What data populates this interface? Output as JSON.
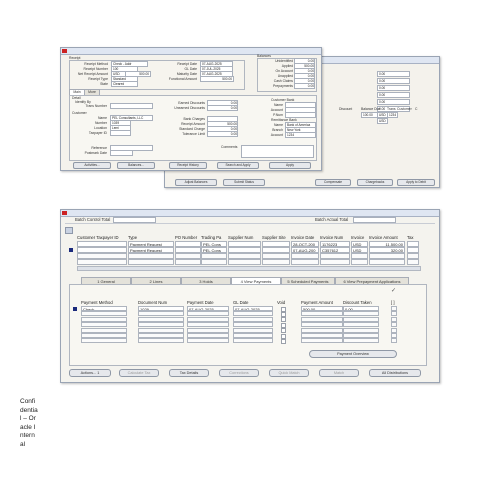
{
  "colors": {
    "selected_row": "#1b2a7c",
    "close_box": "#cc2222",
    "titlebar": "#dfe6f2"
  },
  "icons": {
    "close": "close-icon",
    "calendar": "calendar-icon",
    "flashlight": "flashlight-icon",
    "checkmark": "checkmark-icon",
    "scroll_up": "chevron-up-icon",
    "scroll_down": "chevron-down-icon"
  },
  "receipts_window": {
    "receipt_section": "Receipt",
    "fields": {
      "receipt_method_label": "Receipt Method",
      "receipt_method_value": "Check - Addr",
      "receipt_number_label": "Receipt Number",
      "receipt_number_value": "100",
      "net_receipt_amount_label": "Net Receipt Amount",
      "net_receipt_amount_currency": "USD",
      "net_receipt_amount_value": "500.00",
      "receipt_type_label": "Receipt Type",
      "receipt_type_value": "Standard",
      "state_label": "State",
      "state_value": "Cleared",
      "receipt_date_label": "Receipt Date",
      "receipt_date_value": "07-AUG-2025",
      "gl_date_label": "GL Date",
      "gl_date_value": "07-JUL-2025",
      "maturity_date_label": "Maturity Date",
      "maturity_date_value": "07-AUG-2025",
      "functional_amount_label": "Functional Amount",
      "functional_amount_value": "500.00"
    },
    "balances": {
      "title": "Balances",
      "rows": [
        {
          "label": "Unidentified",
          "value": "0.00"
        },
        {
          "label": "Applied",
          "value": "500.00"
        },
        {
          "label": "On Account",
          "value": "0.00"
        },
        {
          "label": "Unapplied",
          "value": "0.00"
        },
        {
          "label": "Cash Claims",
          "value": "0.00"
        },
        {
          "label": "Prepayments",
          "value": "0.00"
        }
      ]
    },
    "tabs": [
      "Main",
      "More"
    ],
    "main_tab": {
      "detail_label": "Detail",
      "identify_by_label": "Identify By",
      "trans_number_label": "Trans Number",
      "customer_label": "Customer",
      "name_label": "Name",
      "name_value": "PEL Consultants, LLC",
      "number_label": "Number",
      "number_value": "1039",
      "location_label": "Location",
      "location_value": "Lemi",
      "taxpayer_id_label": "Taxpayer ID",
      "reference_label": "Reference",
      "postmark_date_label": "Postmark Date",
      "earned_discounts_label": "Earned Discounts",
      "earned_discounts_value": "0.00",
      "unearned_discounts_label": "Unearned Discounts",
      "unearned_discounts_value": "0.00",
      "bank_charges_label": "Bank Charges",
      "receipt_amount_label": "Receipt Amount",
      "receipt_amount_value": "500.00",
      "standard_charge_label": "Standard Charge",
      "standard_charge_value": "0.00",
      "tolerance_limit_label": "Tolerance Limit",
      "tolerance_limit_value": "0.00",
      "customer_bank_label": "Customer Bank",
      "bank_name_label": "Name",
      "account_label": "Account",
      "pnum_label": "P.Num",
      "remittance_bank_label": "Remittance Bank",
      "rb_name_label": "Name",
      "rb_name_value": "Bank of America",
      "rb_branch_label": "Branch",
      "rb_branch_value": "New York",
      "rb_account_label": "Account",
      "rb_account_value": "1234",
      "comments_label": "Comments"
    },
    "buttons": [
      "Activities...",
      "Balances...",
      "Receipt History",
      "Search and Apply",
      "Apply"
    ]
  },
  "background_window": {
    "values": [
      "0.00",
      "0.00",
      "0.00",
      "0.00",
      "0.00",
      "0.00"
    ],
    "headers": [
      "Discount",
      "Balance Due",
      "Trans",
      "Customer",
      "C"
    ],
    "row1": [
      "100.00",
      "USD",
      "1234"
    ],
    "row2": [
      "USD"
    ],
    "buttons": [
      "Adjust Balances",
      "Submit Status",
      "Compensate",
      "Chargebacks",
      "Apply to Debit"
    ]
  },
  "batch_window": {
    "batch_control_total_label": "Batch Control Total",
    "batch_actual_total_label": "Batch Actual Total",
    "headers": [
      "Customer Taxpayer ID",
      "Type",
      "PO Number",
      "Trading Pa",
      "Supplier Num",
      "Supplier Site",
      "Invoice Date",
      "Invoice Num",
      "Invoice",
      "Invoice Amount",
      "Tax"
    ],
    "rows": [
      [
        "",
        "Payment Request",
        "",
        "PEL Cons",
        "",
        "",
        "28-OCT-200",
        "1176223",
        "USD",
        "11,500.00",
        ""
      ],
      [
        "",
        "Payment Request",
        "",
        "PEL Cons",
        "",
        "",
        "07-AUG-200",
        "C357612",
        "USD",
        "320.00",
        ""
      ],
      [
        "",
        "",
        "",
        "",
        "",
        "",
        "",
        "",
        "",
        "",
        ""
      ],
      [
        "",
        "",
        "",
        "",
        "",
        "",
        "",
        "",
        "",
        "",
        ""
      ]
    ],
    "tabs": [
      "1 General",
      "2 Lines",
      "3 Holds",
      "4 View Payments",
      "5 Scheduled Payments",
      "6 View Prepayment Applications"
    ],
    "payment_headers": [
      "Payment Method",
      "Document Num",
      "Payment Date",
      "GL Date",
      "Void",
      "Payment Amount",
      "Discount Taken",
      "[ ]"
    ],
    "payment_rows": [
      [
        "Check",
        "1029",
        "07-AUG-2025",
        "07-AUG-2025",
        "",
        "500.00",
        "0.00"
      ],
      [
        "",
        "",
        "",
        "",
        "",
        "",
        ""
      ],
      [
        "",
        "",
        "",
        "",
        "",
        "",
        ""
      ],
      [
        "",
        "",
        "",
        "",
        "",
        "",
        ""
      ],
      [
        "",
        "",
        "",
        "",
        "",
        "",
        ""
      ],
      [
        "",
        "",
        "",
        "",
        "",
        "",
        ""
      ],
      [
        "",
        "",
        "",
        "",
        "",
        "",
        ""
      ]
    ],
    "payment_overview_button": "Payment Overview",
    "buttons": [
      "Actions... 1",
      "Calculate Tax",
      "Tax Details",
      "Corrections",
      "Quick Match",
      "Match",
      "All Distributions"
    ]
  },
  "side_caption": "Confidential – Oracle Internal"
}
